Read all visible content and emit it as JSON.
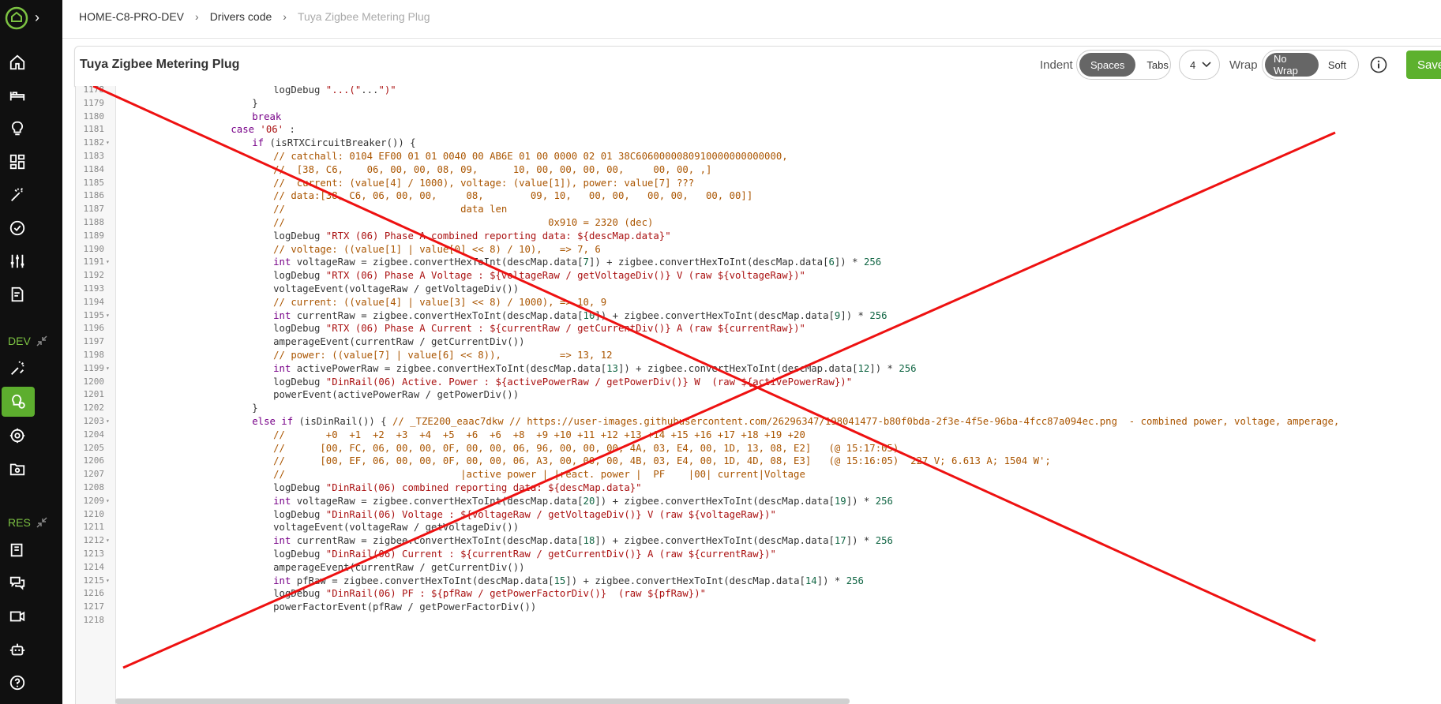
{
  "breadcrumb": [
    "HOME-C8-PRO-DEV",
    "Drivers code",
    "Tuya Zigbee Metering Plug"
  ],
  "sidebar": {
    "sections": [
      "DEV",
      "RES"
    ]
  },
  "toolbar": {
    "title": "Tuya Zigbee Metering Plug",
    "indent_label": "Indent",
    "indent_options": [
      "Spaces",
      "Tabs"
    ],
    "indent_selected": "Spaces",
    "indent_size": "4",
    "wrap_label": "Wrap",
    "wrap_options": [
      "No Wrap",
      "Soft"
    ],
    "wrap_selected": "No Wrap",
    "save_label": "Save"
  },
  "code_lines": [
    {
      "n": "1178",
      "f": false,
      "i": 28,
      "t": "logDebug \"...(\"...\")\""
    },
    {
      "n": "1179",
      "f": false,
      "i": 24,
      "t": "}"
    },
    {
      "n": "1180",
      "f": false,
      "i": 24,
      "t": "break"
    },
    {
      "n": "1181",
      "f": false,
      "i": 20,
      "t": "case '06' :"
    },
    {
      "n": "1182",
      "f": true,
      "i": 24,
      "t": "if (isRTXCircuitBreaker()) {"
    },
    {
      "n": "1183",
      "f": false,
      "i": 28,
      "t": "// catchall: 0104 EF00 01 01 0040 00 AB6E 01 00 0000 02 01 38C6060000080910000000000000,"
    },
    {
      "n": "1184",
      "f": false,
      "i": 28,
      "t": "//  [38, C6,    06, 00, 00, 08, 09,      10, 00, 00, 00, 00,     00, 00, ,]"
    },
    {
      "n": "1185",
      "f": false,
      "i": 28,
      "t": "//  current: (value[4] / 1000), voltage: (value[1]), power: value[7] ???"
    },
    {
      "n": "1186",
      "f": false,
      "i": 28,
      "t": "// data:[38, C6, 06, 00, 00,     08,        09, 10,   00, 00,   00, 00,   00, 00]]"
    },
    {
      "n": "1187",
      "f": false,
      "i": 28,
      "t": "//                              data len"
    },
    {
      "n": "1188",
      "f": false,
      "i": 28,
      "t": "//                                             0x910 = 2320 (dec)"
    },
    {
      "n": "1189",
      "f": false,
      "i": 28,
      "t": "logDebug \"RTX (06) Phase A combined reporting data: ${descMap.data}\""
    },
    {
      "n": "1190",
      "f": false,
      "i": 28,
      "t": "// voltage: ((value[1] | value[0] << 8) / 10),   => 7, 6"
    },
    {
      "n": "1191",
      "f": true,
      "i": 28,
      "t": "int voltageRaw = zigbee.convertHexToInt(descMap.data[7]) + zigbee.convertHexToInt(descMap.data[6]) * 256"
    },
    {
      "n": "1192",
      "f": false,
      "i": 28,
      "t": "logDebug \"RTX (06) Phase A Voltage : ${voltageRaw / getVoltageDiv()} V (raw ${voltageRaw})\""
    },
    {
      "n": "1193",
      "f": false,
      "i": 28,
      "t": "voltageEvent(voltageRaw / getVoltageDiv())"
    },
    {
      "n": "1194",
      "f": false,
      "i": 28,
      "t": "// current: ((value[4] | value[3] << 8) / 1000), => 10, 9"
    },
    {
      "n": "1195",
      "f": true,
      "i": 28,
      "t": "int currentRaw = zigbee.convertHexToInt(descMap.data[10]) + zigbee.convertHexToInt(descMap.data[9]) * 256"
    },
    {
      "n": "1196",
      "f": false,
      "i": 28,
      "t": "logDebug \"RTX (06) Phase A Current : ${currentRaw / getCurrentDiv()} A (raw ${currentRaw})\""
    },
    {
      "n": "1197",
      "f": false,
      "i": 28,
      "t": "amperageEvent(currentRaw / getCurrentDiv())"
    },
    {
      "n": "1198",
      "f": false,
      "i": 28,
      "t": "// power: ((value[7] | value[6] << 8)),          => 13, 12"
    },
    {
      "n": "1199",
      "f": true,
      "i": 28,
      "t": "int activePowerRaw = zigbee.convertHexToInt(descMap.data[13]) + zigbee.convertHexToInt(descMap.data[12]) * 256"
    },
    {
      "n": "1200",
      "f": false,
      "i": 28,
      "t": "logDebug \"DinRail(06) Active. Power : ${activePowerRaw / getPowerDiv()} W  (raw ${activePowerRaw})\""
    },
    {
      "n": "1201",
      "f": false,
      "i": 28,
      "t": "powerEvent(activePowerRaw / getPowerDiv())"
    },
    {
      "n": "1202",
      "f": false,
      "i": 24,
      "t": "}"
    },
    {
      "n": "1203",
      "f": true,
      "i": 24,
      "t": "else if (isDinRail()) { // _TZE200_eaac7dkw // https://user-images.githubusercontent.com/26296347/198041477-b80f0bda-2f3e-4f5e-96ba-4fcc87a094ec.png  - combined power, voltage, amperage,"
    },
    {
      "n": "1204",
      "f": false,
      "i": 28,
      "t": "//       +0  +1  +2  +3  +4  +5  +6  +6  +8  +9 +10 +11 +12 +13 +14 +15 +16 +17 +18 +19 +20"
    },
    {
      "n": "1205",
      "f": false,
      "i": 28,
      "t": "//      [00, FC, 06, 00, 00, 0F, 00, 00, 06, 96, 00, 00, 00, 4A, 03, E4, 00, 1D, 13, 08, E2]   (@ 15:17:05)"
    },
    {
      "n": "1206",
      "f": false,
      "i": 28,
      "t": "//      [00, EF, 06, 00, 00, 0F, 00, 00, 06, A3, 00, 00, 00, 4B, 03, E4, 00, 1D, 4D, 08, E3]   (@ 15:16:05)  227 V; 6.613 A; 1504 W';"
    },
    {
      "n": "1207",
      "f": false,
      "i": 28,
      "t": "//                              |active power | |react. power |  PF    |00| current|Voltage"
    },
    {
      "n": "1208",
      "f": false,
      "i": 28,
      "t": "logDebug \"DinRail(06) combined reporting data: ${descMap.data}\""
    },
    {
      "n": "1209",
      "f": true,
      "i": 28,
      "t": "int voltageRaw = zigbee.convertHexToInt(descMap.data[20]) + zigbee.convertHexToInt(descMap.data[19]) * 256"
    },
    {
      "n": "1210",
      "f": false,
      "i": 28,
      "t": "logDebug \"DinRail(06) Voltage : ${voltageRaw / getVoltageDiv()} V (raw ${voltageRaw})\""
    },
    {
      "n": "1211",
      "f": false,
      "i": 28,
      "t": "voltageEvent(voltageRaw / getVoltageDiv())"
    },
    {
      "n": "1212",
      "f": true,
      "i": 28,
      "t": "int currentRaw = zigbee.convertHexToInt(descMap.data[18]) + zigbee.convertHexToInt(descMap.data[17]) * 256"
    },
    {
      "n": "1213",
      "f": false,
      "i": 28,
      "t": "logDebug \"DinRail(06) Current : ${currentRaw / getCurrentDiv()} A (raw ${currentRaw})\""
    },
    {
      "n": "1214",
      "f": false,
      "i": 28,
      "t": "amperageEvent(currentRaw / getCurrentDiv())"
    },
    {
      "n": "1215",
      "f": true,
      "i": 28,
      "t": "int pfRaw = zigbee.convertHexToInt(descMap.data[15]) + zigbee.convertHexToInt(descMap.data[14]) * 256"
    },
    {
      "n": "1216",
      "f": false,
      "i": 28,
      "t": "logDebug \"DinRail(06) PF : ${pfRaw / getPowerFactorDiv()}  (raw ${pfRaw})\""
    },
    {
      "n": "1217",
      "f": false,
      "i": 28,
      "t": "powerFactorEvent(pfRaw / getPowerFactorDiv())"
    },
    {
      "n": "1218",
      "f": false,
      "i": 28,
      "t": ""
    }
  ],
  "colors": {
    "sidebar_bg": "#101010",
    "accent": "#5db12e",
    "overlay_cross": "#ee1111"
  }
}
